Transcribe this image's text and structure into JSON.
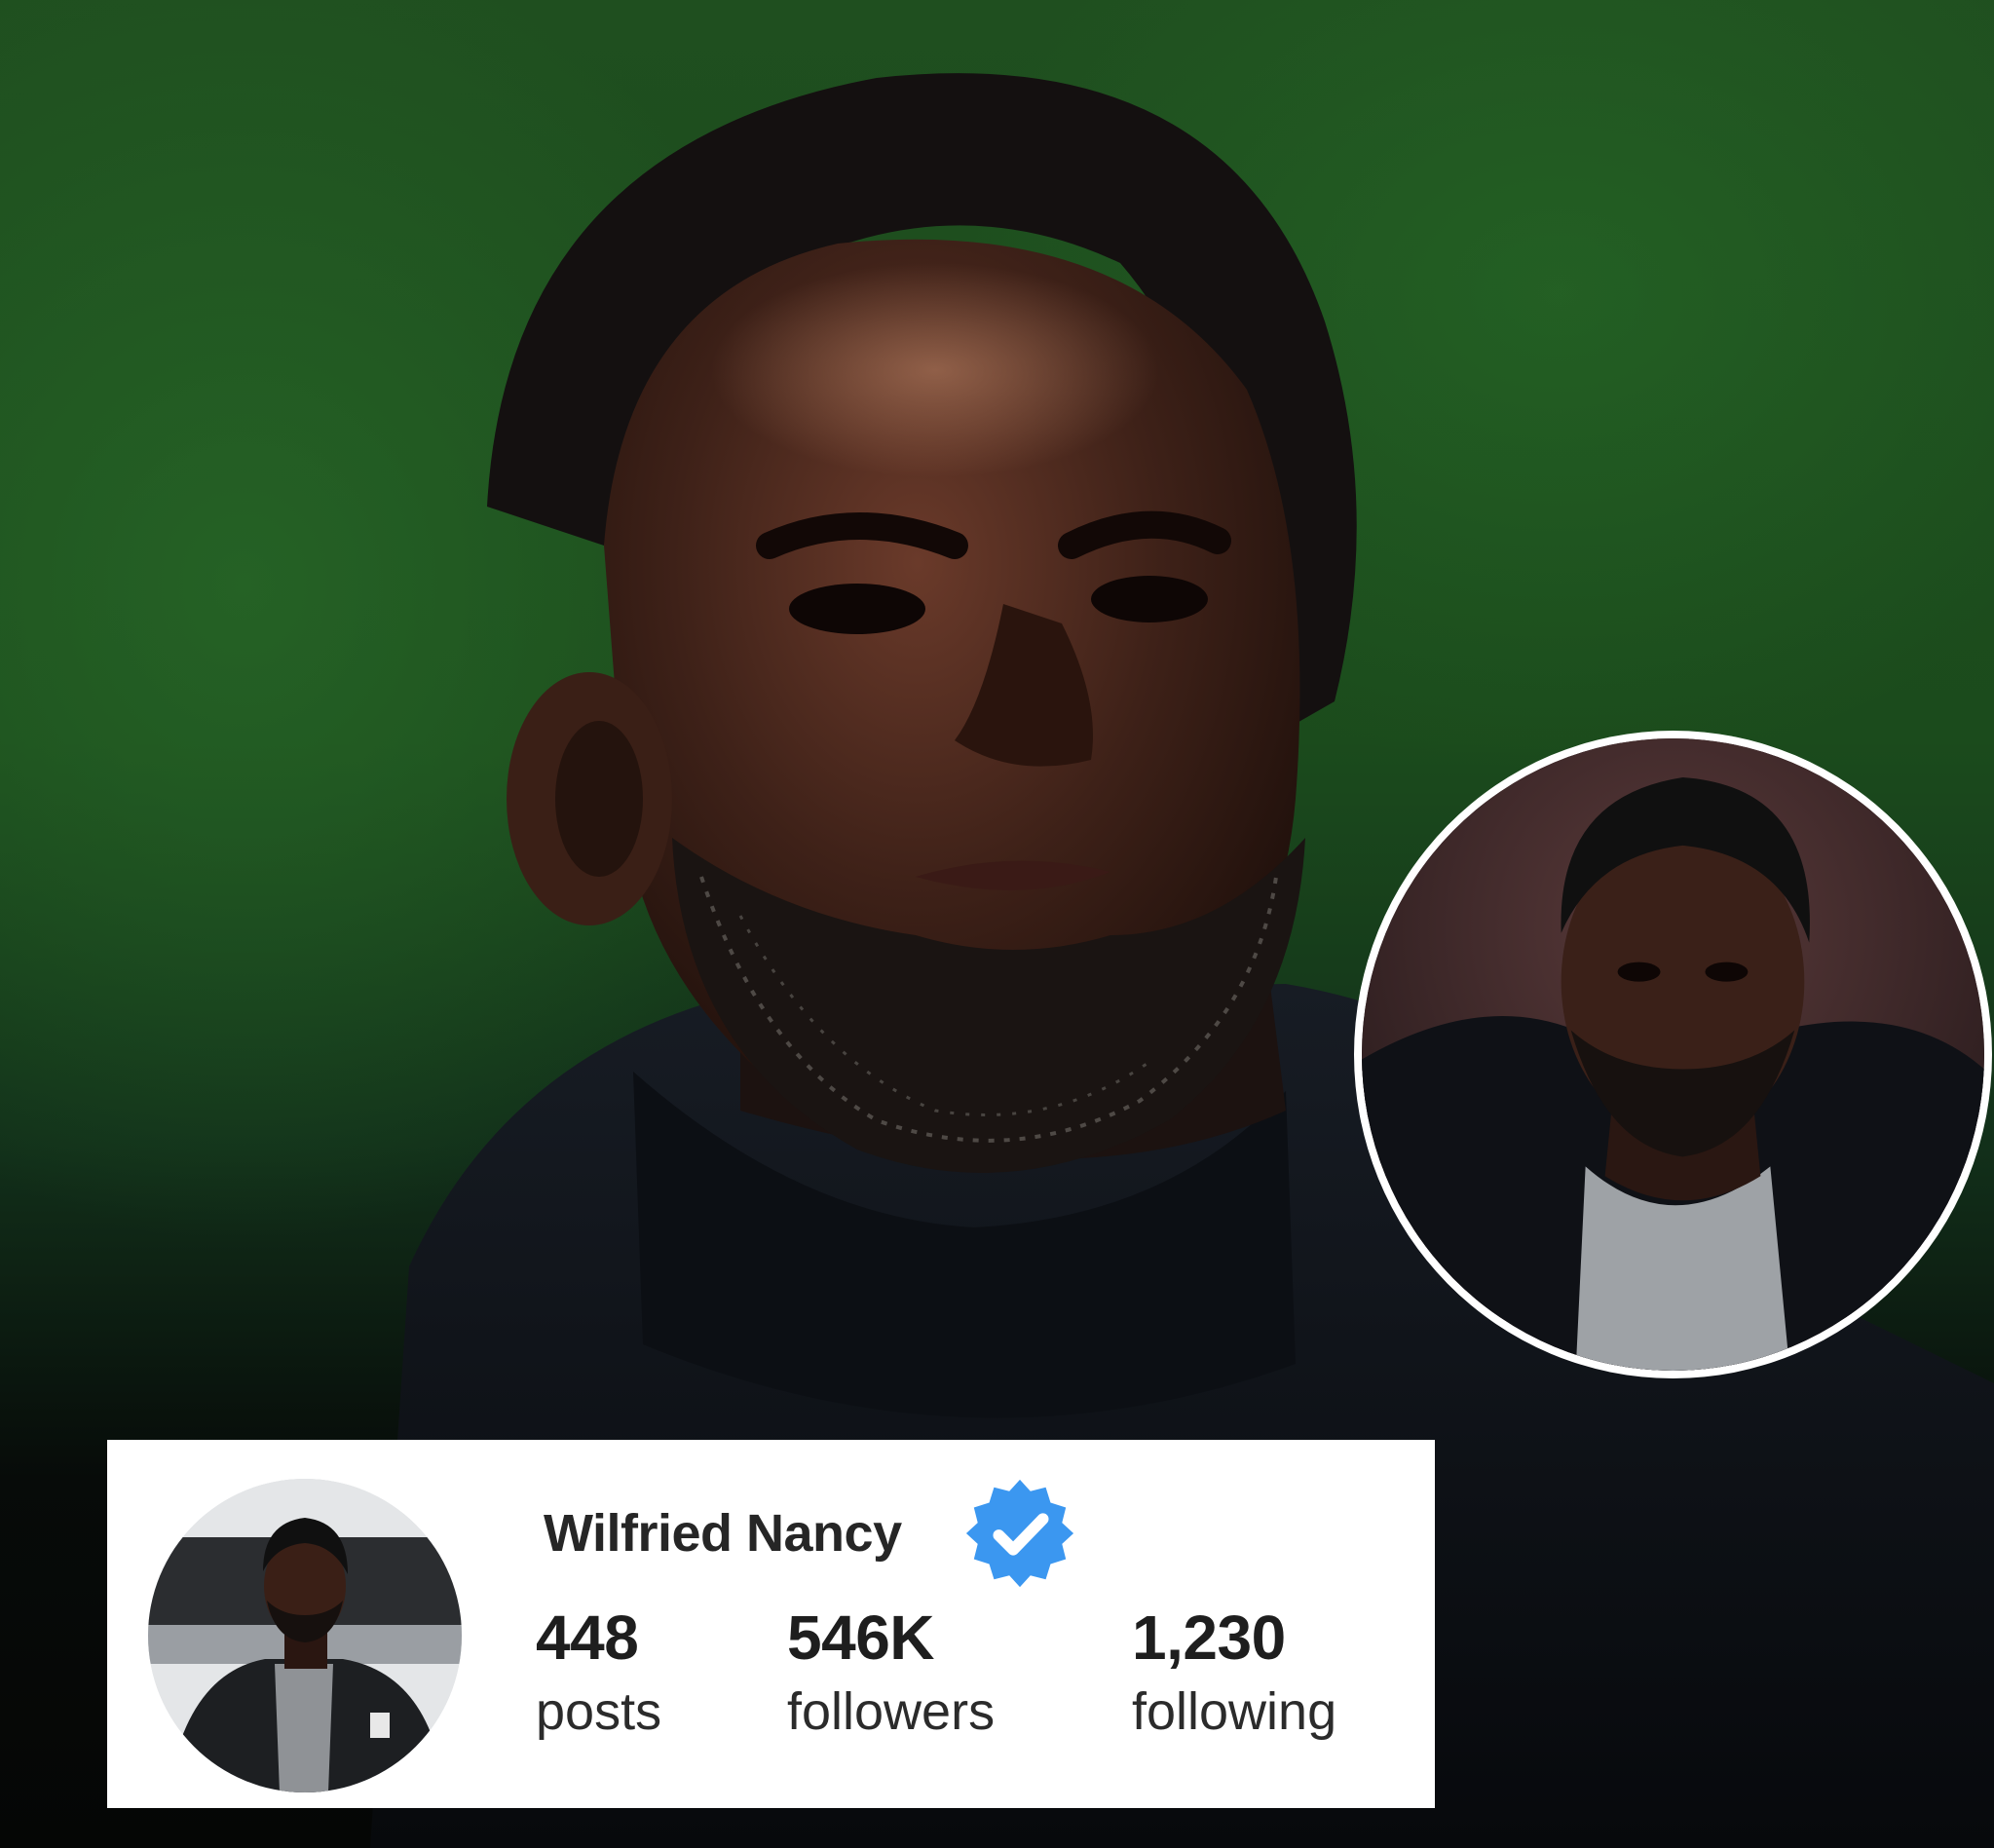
{
  "profile": {
    "name": "Wilfried Nancy",
    "verified": true,
    "verified_color": "#3b97f0",
    "stats": [
      {
        "value": "448",
        "label": "posts"
      },
      {
        "value": "546K",
        "label": "followers"
      },
      {
        "value": "1,230",
        "label": "following"
      }
    ]
  },
  "background": {
    "color": "#1f4f1f"
  },
  "icons": {
    "verified": "verified-badge-icon"
  }
}
